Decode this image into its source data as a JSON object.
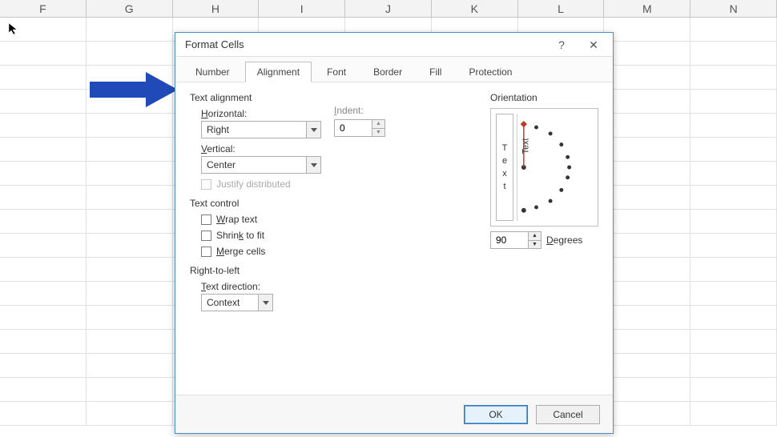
{
  "columns": [
    "F",
    "G",
    "H",
    "I",
    "J",
    "K",
    "L",
    "M",
    "N"
  ],
  "dialog": {
    "title": "Format Cells",
    "tabs": [
      "Number",
      "Alignment",
      "Font",
      "Border",
      "Fill",
      "Protection"
    ],
    "active_tab": "Alignment",
    "text_alignment": {
      "group": "Text alignment",
      "horizontal_label": "Horizontal:",
      "horizontal_value": "Right",
      "vertical_label": "Vertical:",
      "vertical_value": "Center",
      "indent_label": "Indent:",
      "indent_value": "0",
      "justify_distributed_label": "Justify distributed"
    },
    "text_control": {
      "group": "Text control",
      "wrap_label": "Wrap text",
      "shrink_label": "Shrink to fit",
      "merge_label": "Merge cells"
    },
    "rtl": {
      "group": "Right-to-left",
      "direction_label": "Text direction:",
      "direction_value": "Context"
    },
    "orientation": {
      "group": "Orientation",
      "vertical_text": "Text",
      "angled_text": "Text",
      "degrees_value": "90",
      "degrees_label": "Degrees"
    },
    "buttons": {
      "ok": "OK",
      "cancel": "Cancel"
    },
    "help": "?",
    "close": "✕"
  },
  "annotation": {
    "color": "#1f4ab8"
  }
}
